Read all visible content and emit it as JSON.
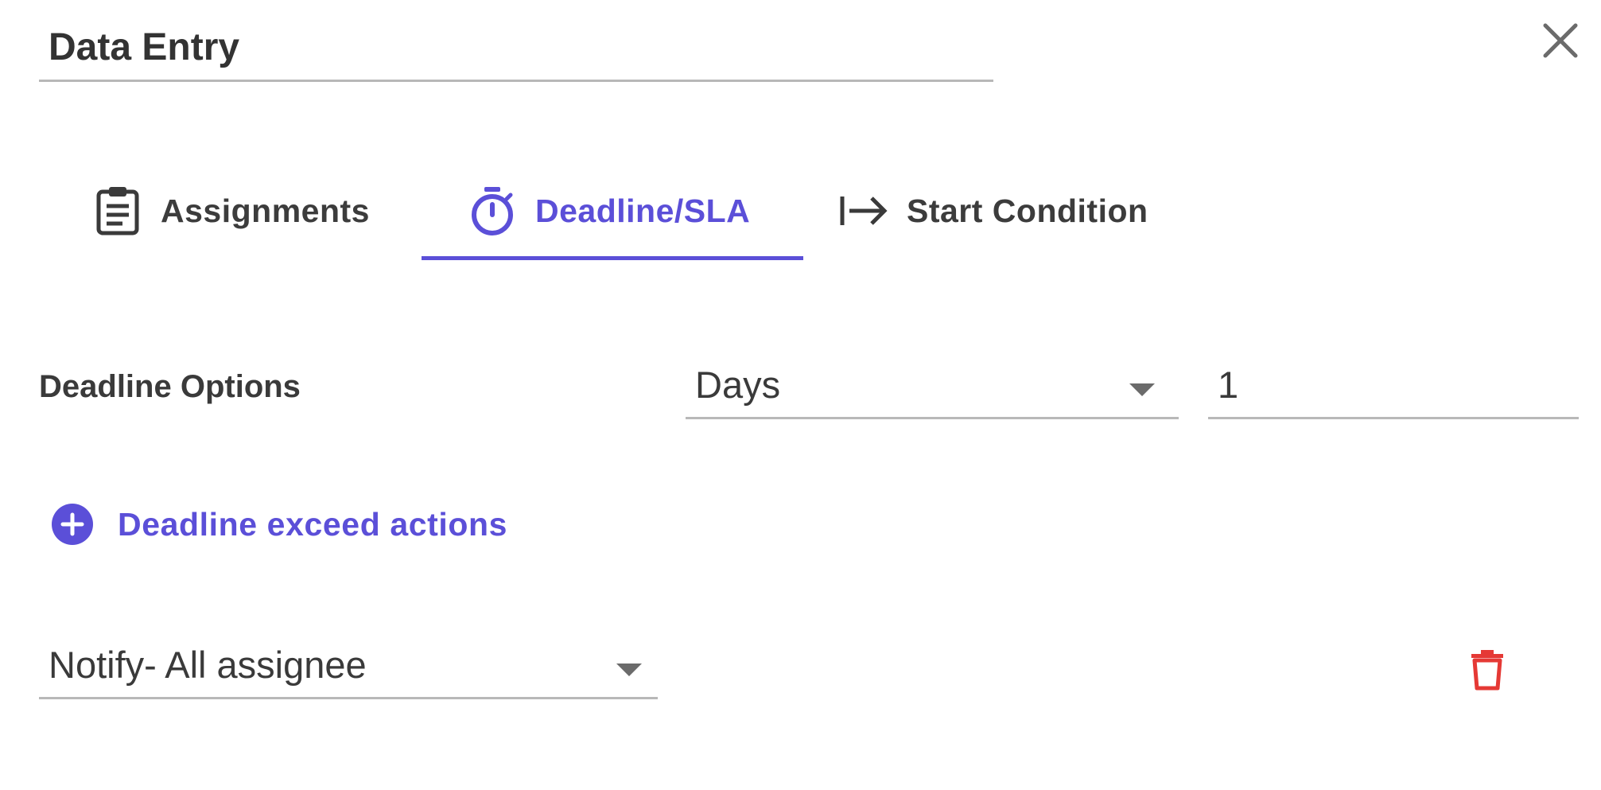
{
  "header": {
    "title": "Data Entry",
    "close_icon": "close-icon"
  },
  "tabs": [
    {
      "label": "Assignments",
      "icon": "clipboard-icon",
      "active": false
    },
    {
      "label": "Deadline/SLA",
      "icon": "timer-icon",
      "active": true
    },
    {
      "label": "Start Condition",
      "icon": "arrow-right-to-line-icon",
      "active": false
    }
  ],
  "deadline": {
    "label": "Deadline Options",
    "unit_select": {
      "value": "Days"
    },
    "amount_input": {
      "value": "1"
    }
  },
  "actions": {
    "add_label": "Deadline exceed actions",
    "items": [
      {
        "value": "Notify- All assignee",
        "delete_icon": "trash-icon"
      }
    ]
  },
  "colors": {
    "accent": "#5b4fd8",
    "text": "#3c3c3c",
    "danger": "#e53935",
    "underline": "#b8b8b8"
  }
}
